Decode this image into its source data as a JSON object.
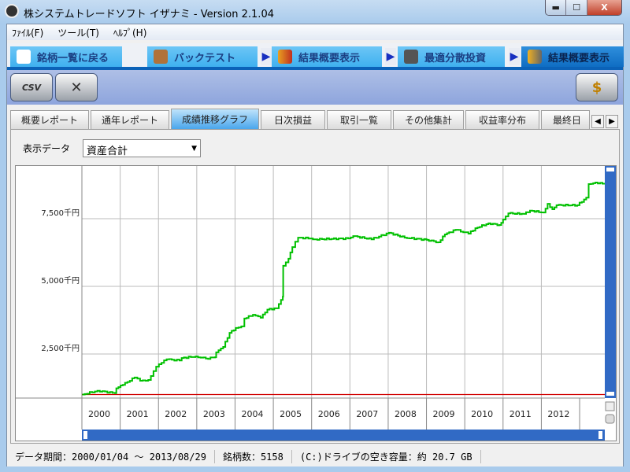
{
  "window": {
    "title": "株システムトレードソフト イザナミ - Version 2.1.04",
    "minimize": "▬",
    "maximize": "☐",
    "close": "X"
  },
  "menu": [
    {
      "label": "ﾌｧｲﾙ(F)"
    },
    {
      "label": "ツール(T)"
    },
    {
      "label": "ﾍﾙﾌﾟ(H)"
    }
  ],
  "nav": [
    {
      "label": "銘柄一覧に戻る",
      "icon": "tshirt-icon"
    },
    {
      "label": "バックテスト",
      "icon": "backpack-icon"
    },
    {
      "label": "結果概要表示",
      "icon": "bar-chart-icon"
    },
    {
      "label": "最適分散投資",
      "icon": "calculator-icon"
    },
    {
      "label": "結果概要表示",
      "icon": "bar-chart-calculator-icon",
      "active": true
    }
  ],
  "toolbar": {
    "csv_label": "CSV",
    "csv_icon": "excel-csv-icon",
    "tools_icon": "wrench-hammer-icon",
    "money_icon": "money-chest-icon"
  },
  "subtabs": [
    "概要レポート",
    "通年レポート",
    "成績推移グラフ",
    "日次損益",
    "取引一覧",
    "その他集計",
    "収益率分布",
    "最終日"
  ],
  "subtab_active": 2,
  "display": {
    "label": "表示データ",
    "selected": "資産合計"
  },
  "chart_data": {
    "type": "line",
    "x_ticks": [
      "2000",
      "2001",
      "2002",
      "2003",
      "2004",
      "2005",
      "2006",
      "2007",
      "2008",
      "2009",
      "2010",
      "2011",
      "2012"
    ],
    "y_ticks": [
      {
        "value": 2500,
        "label": "2,500千円"
      },
      {
        "value": 5000,
        "label": "5,000千円"
      },
      {
        "value": 7500,
        "label": "7,500千円"
      }
    ],
    "xlim": [
      "2000-01-04",
      "2013-08-29"
    ],
    "ylim": [
      870,
      9450
    ],
    "grid": true,
    "series": [
      {
        "color": "#00c000",
        "points": [
          [
            "2000-01-04",
            1000
          ],
          [
            "2000-05-28",
            1140
          ],
          [
            "2000-11-12",
            1050
          ],
          [
            "2000-11-25",
            1230
          ],
          [
            "2001-01-25",
            1360
          ],
          [
            "2001-05-18",
            1630
          ],
          [
            "2001-07-10",
            1510
          ],
          [
            "2001-09-25",
            1540
          ],
          [
            "2001-12-10",
            2030
          ],
          [
            "2002-01-05",
            2120
          ],
          [
            "2002-03-20",
            2300
          ],
          [
            "2002-07-20",
            2260
          ],
          [
            "2002-08-10",
            2350
          ],
          [
            "2002-12-20",
            2410
          ],
          [
            "2003-03-28",
            2330
          ],
          [
            "2003-06-25",
            2380
          ],
          [
            "2003-07-05",
            2560
          ],
          [
            "2003-09-10",
            2760
          ],
          [
            "2003-11-10",
            3280
          ],
          [
            "2004-01-08",
            3460
          ],
          [
            "2004-03-01",
            3520
          ],
          [
            "2004-03-30",
            3810
          ],
          [
            "2004-06-20",
            3950
          ],
          [
            "2004-09-01",
            3840
          ],
          [
            "2004-11-05",
            4140
          ],
          [
            "2005-02-01",
            4190
          ],
          [
            "2005-03-15",
            4500
          ],
          [
            "2005-04-01",
            4620
          ],
          [
            "2005-04-05",
            5760
          ],
          [
            "2005-05-25",
            6020
          ],
          [
            "2005-07-01",
            6450
          ],
          [
            "2005-08-25",
            6800
          ],
          [
            "2005-12-25",
            6770
          ],
          [
            "2006-02-01",
            6740
          ],
          [
            "2006-12-15",
            6770
          ],
          [
            "2007-02-01",
            6860
          ],
          [
            "2007-07-25",
            6740
          ],
          [
            "2008-01-08",
            6980
          ],
          [
            "2008-06-05",
            6800
          ],
          [
            "2009-01-01",
            6720
          ],
          [
            "2009-04-25",
            6630
          ],
          [
            "2009-06-25",
            6920
          ],
          [
            "2009-10-05",
            7090
          ],
          [
            "2010-02-05",
            6950
          ],
          [
            "2010-04-12",
            7150
          ],
          [
            "2010-08-15",
            7330
          ],
          [
            "2010-11-28",
            7270
          ],
          [
            "2011-01-01",
            7470
          ],
          [
            "2011-02-20",
            7700
          ],
          [
            "2011-07-20",
            7680
          ],
          [
            "2011-09-15",
            7800
          ],
          [
            "2012-01-20",
            7730
          ],
          [
            "2012-03-01",
            8050
          ],
          [
            "2012-04-15",
            7850
          ],
          [
            "2012-05-25",
            8000
          ],
          [
            "2012-12-10",
            8000
          ],
          [
            "2013-03-05",
            8280
          ],
          [
            "2013-03-28",
            8780
          ],
          [
            "2013-06-01",
            8840
          ],
          [
            "2013-08-29",
            8780
          ]
        ]
      }
    ],
    "reference_line": {
      "value": 1000,
      "color": "#d00000"
    }
  },
  "status": {
    "period": "データ期間：2000/01/04 ～ 2013/08/29",
    "count": "銘柄数：5158",
    "drive": "(C:)ドライブの空き容量：約 20.7 GB"
  },
  "colors": {
    "accent": "#0b62b8",
    "scrollbar": "#316ac5"
  }
}
